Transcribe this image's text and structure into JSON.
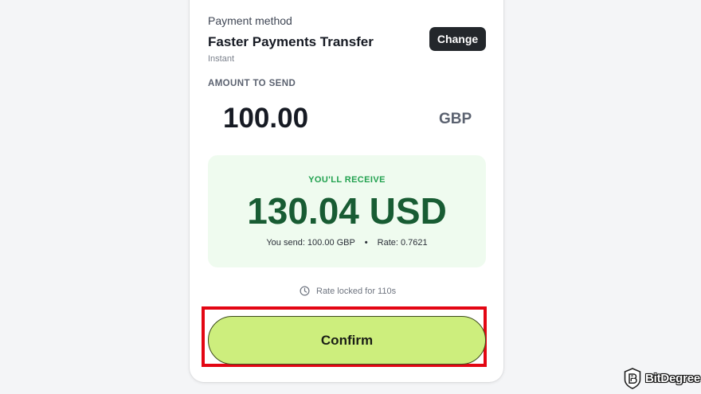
{
  "payment": {
    "label": "Payment method",
    "title": "Faster Payments Transfer",
    "subtitle": "Instant",
    "change_label": "Change"
  },
  "amount": {
    "label": "AMOUNT TO SEND",
    "value": "100.00",
    "currency": "GBP"
  },
  "receive": {
    "label": "YOU'LL RECEIVE",
    "value": "130.04 USD",
    "send_info": "You send: 100.00 GBP",
    "separator": "•",
    "rate_info": "Rate: 0.7621"
  },
  "rate_lock": {
    "icon": "clock-icon",
    "text": "Rate locked for 110s"
  },
  "confirm": {
    "label": "Confirm"
  },
  "watermark": {
    "icon": "bitdegree-logo-icon",
    "text": "BitDegree"
  },
  "colors": {
    "accent_button": "#cdee7d",
    "receive_bg": "#effbef",
    "receive_value": "#185c33",
    "receive_label": "#21a14f",
    "highlight": "#e30613"
  }
}
